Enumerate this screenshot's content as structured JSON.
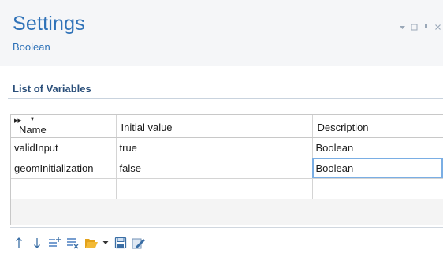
{
  "header": {
    "title": "Settings",
    "subtitle": "Boolean"
  },
  "section": {
    "title": "List of Variables"
  },
  "table": {
    "columns": [
      "Name",
      "Initial value",
      "Description"
    ],
    "rows": [
      [
        "validInput",
        "true",
        "Boolean"
      ],
      [
        "geomInitialization",
        "false",
        "Boolean"
      ],
      [
        "",
        "",
        ""
      ]
    ]
  },
  "icons": {
    "window_controls": [
      "dropdown-icon",
      "maximize-icon",
      "pin-icon",
      "close-icon"
    ],
    "toolbar": [
      "move-up-icon",
      "move-down-icon",
      "add-row-icon",
      "clear-table-icon",
      "load-from-file-icon",
      "dropdown-arrow-icon",
      "save-to-file-icon",
      "edit-icon"
    ]
  },
  "colors": {
    "accent": "#2f72b8",
    "section": "#2b4f7a",
    "selection": "#7aaee4"
  }
}
